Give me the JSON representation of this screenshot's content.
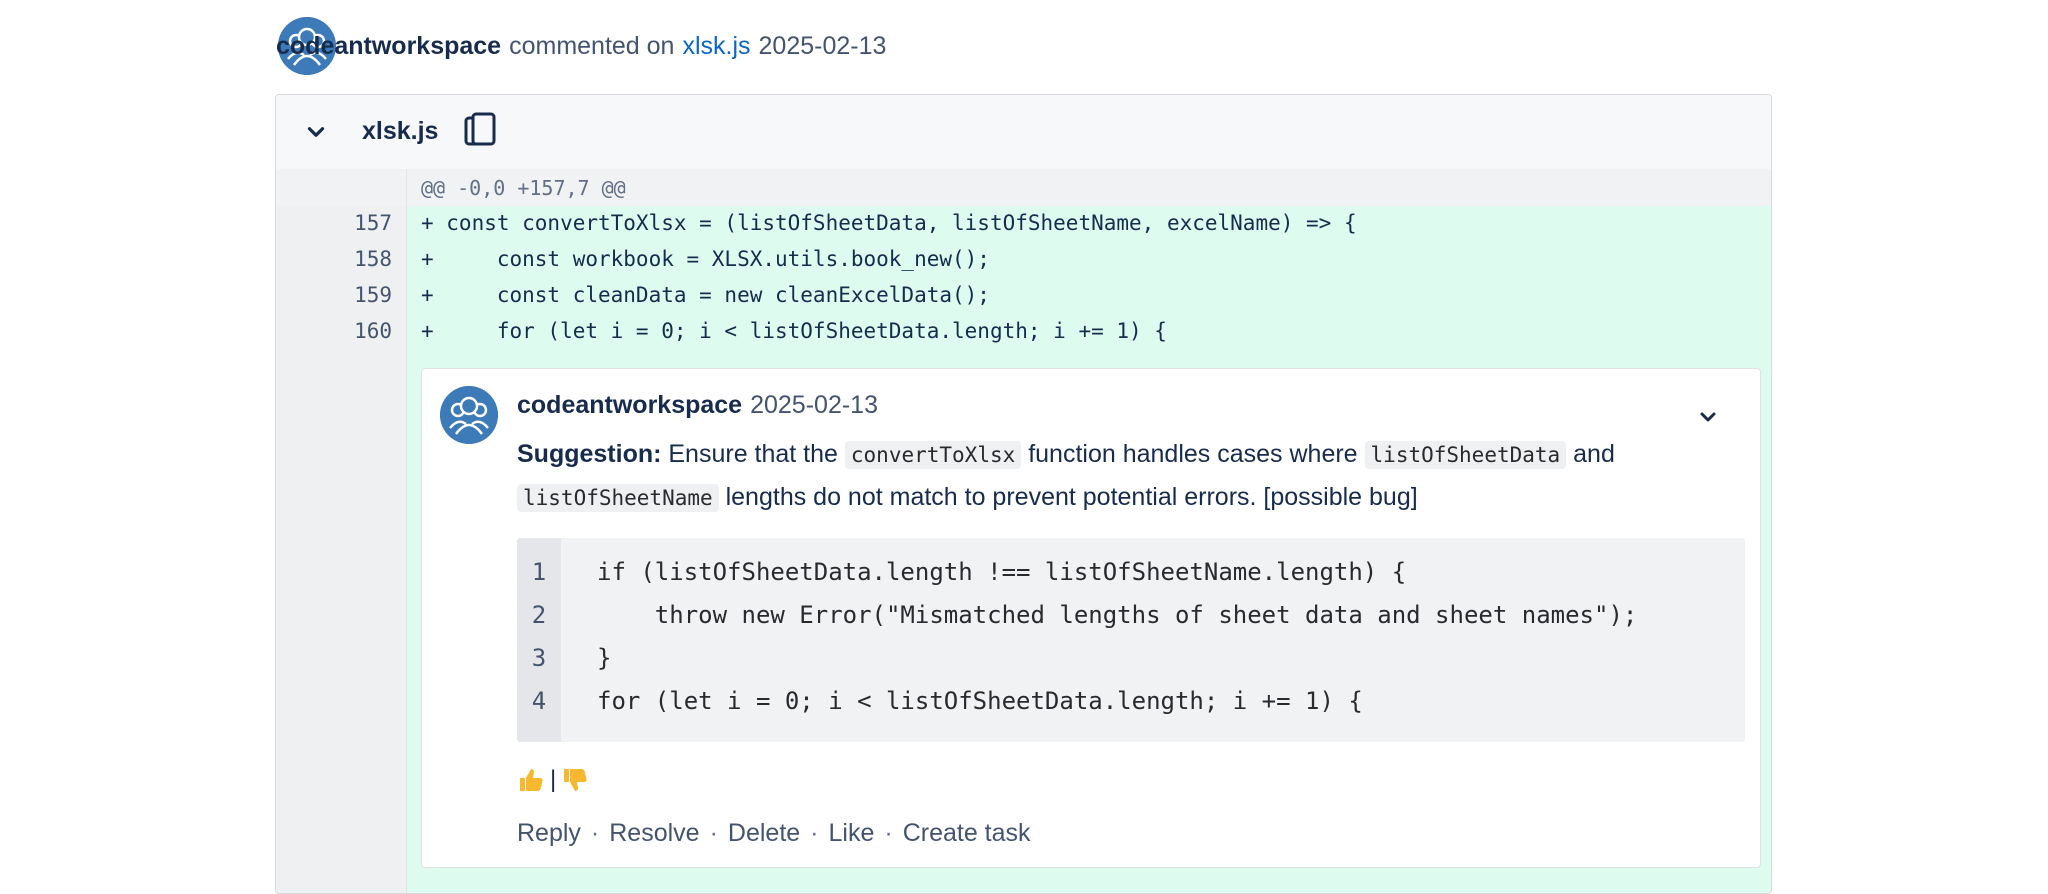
{
  "top_comment": {
    "author": "codeantworkspace",
    "action": "commented on",
    "file_link": "xlsk.js",
    "date": "2025-02-13"
  },
  "file": {
    "name": "xlsk.js",
    "hunk_header": "@@ -0,0 +157,7 @@"
  },
  "diff_lines": [
    {
      "num": "157",
      "code": "+ const convertToXlsx = (listOfSheetData, listOfSheetName, excelName) => {"
    },
    {
      "num": "158",
      "code": "+     const workbook = XLSX.utils.book_new();"
    },
    {
      "num": "159",
      "code": "+     const cleanData = new cleanExcelData();"
    },
    {
      "num": "160",
      "code": "+     for (let i = 0; i < listOfSheetData.length; i += 1) {"
    }
  ],
  "inline_comment": {
    "author": "codeantworkspace",
    "date": "2025-02-13",
    "suggestion_label": "Suggestion:",
    "text_1": " Ensure that the ",
    "code_1": "convertToXlsx",
    "text_2": " function handles cases where ",
    "code_2": "listOfSheetData",
    "text_3": " and",
    "code_3": "listOfSheetName",
    "text_4": " lengths do not match to prevent potential errors. [possible bug]",
    "snippet": [
      {
        "n": "1",
        "c": "if (listOfSheetData.length !== listOfSheetName.length) {"
      },
      {
        "n": "2",
        "c": "    throw new Error(\"Mismatched lengths of sheet data and sheet names\");"
      },
      {
        "n": "3",
        "c": "}"
      },
      {
        "n": "4",
        "c": "for (let i = 0; i < listOfSheetData.length; i += 1) {"
      }
    ],
    "reaction_separator": "|",
    "actions": {
      "reply": "Reply",
      "resolve": "Resolve",
      "delete": "Delete",
      "like": "Like",
      "create_task": "Create task",
      "dot": "·"
    }
  },
  "colors": {
    "added_bg": "#ddfcef",
    "link": "#0c66c4",
    "avatar": "#3d7ab8",
    "thumb": "#f5b82e"
  }
}
